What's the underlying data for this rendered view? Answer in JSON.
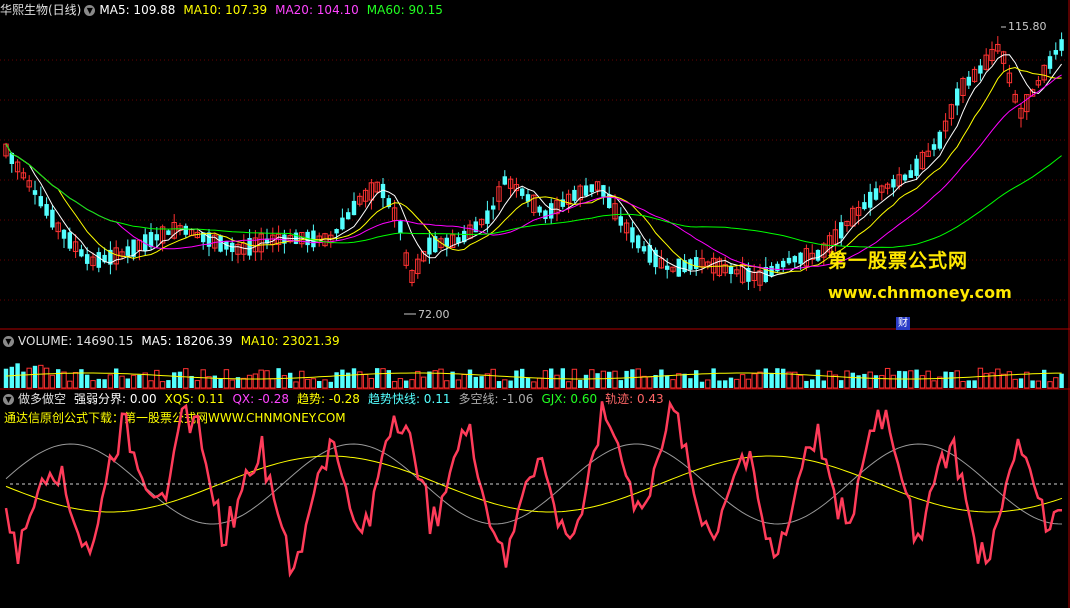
{
  "price_panel": {
    "stock_name": "华熙生物(日线)",
    "ma5": "MA5: 109.88",
    "ma10": "MA10: 107.39",
    "ma20": "MA20: 104.10",
    "ma60": "MA60: 90.15",
    "high_tag": "115.80",
    "low_tag": "72.00",
    "finance_badge": "财"
  },
  "volume_panel": {
    "volume": "VOLUME: 14690.15",
    "ma5": "MA5: 18206.39",
    "ma10": "MA10: 23021.39"
  },
  "indicator_panel": {
    "name": "做多做空",
    "strength_label": "强弱分界: 0.00",
    "xqs": "XQS: 0.11",
    "qx": "QX: -0.28",
    "trend": "趋势: -0.28",
    "trend_fast": "趋势快线: 0.11",
    "long_short": "多空线: -1.06",
    "gjx": "GJX: 0.60",
    "track": "轨迹: 0.43",
    "download_note": "通达信原创公式下载：第一股票公式网WWW.CHNMONEY.COM"
  },
  "watermark": {
    "cn": "第一股票公式网",
    "url": "www.chnmoney.com"
  },
  "colors": {
    "background": "#000000",
    "up": "#ff3232",
    "down": "#54ffff",
    "ma5": "#ffffff",
    "ma10": "#ffff00",
    "ma20": "#ff00ff",
    "ma60": "#00ff00",
    "watermark": "#ffe800"
  }
}
